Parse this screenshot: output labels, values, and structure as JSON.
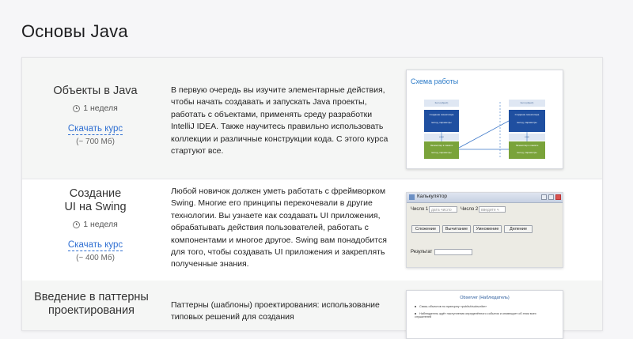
{
  "page": {
    "title": "Основы Java"
  },
  "courses": [
    {
      "title": "Объекты в Java",
      "duration": "1 неделя",
      "download_label": "Скачать курс",
      "size": "(~ 700 Мб)",
      "description": "В первую очередь вы изучите элементарные действия, чтобы начать создавать и запускать Java проекты, работать с объектами, применять среду разработки IntelliJ IDEA. Также научитесь правильно использовать коллекции и различные конструкции кода. С этого курса стартуют все.",
      "thumb": {
        "slide_title": "Схема работы",
        "left_top": "Item.(object)",
        "left_mid": "Создание экземпляра",
        "left_mid_sub": "метод, параметры",
        "left_small": "ещё",
        "left_bottom": "Экземпляр в памяти",
        "left_bottom_sub": "метод, параметры",
        "right_top": "Item.(object)",
        "right_mid": "Создание экземпляра",
        "right_mid_sub": "метод, параметры",
        "right_small": "ещё",
        "right_bottom": "Экземпляр в памяти",
        "right_bottom_sub": "метод, параметры"
      }
    },
    {
      "title": "Создание UI на Swing",
      "title_line1": "Создание",
      "title_line2": "UI на Swing",
      "duration": "1 неделя",
      "download_label": "Скачать курс",
      "size": "(~ 400 Мб)",
      "description": "Любой новичок должен уметь работать с фреймворком Swing. Многие его принципы перекочевали в другие технологии. Вы узнаете как создавать UI приложения, обрабатывать действия пользователей, работать с компонентами и многое другое. Swing вам понадобится для того, чтобы создавать UI приложения и закреплять полученные знания.",
      "thumb": {
        "window_title": "Калькулятор",
        "label_num1": "Число 1",
        "placeholder_num1": "дата число",
        "label_num2": "Число 2",
        "placeholder_num2": "введите ч",
        "btn_add": "Сложение",
        "btn_sub": "Вычитание",
        "btn_mul": "Умножение",
        "btn_div": "Деление",
        "label_result": "Результат"
      }
    },
    {
      "title": "Введение в паттерны проектирования",
      "title_line1": "Введение в паттерны",
      "title_line2": "проектирования",
      "description": "Паттерны (шаблоны) проектирования: использование типовых решений для создания",
      "thumb": {
        "doc_title": "Observer (Наблюдатель)",
        "line1": "Связь объектов по принципу «publish/subscribe»",
        "line2": "Наблюдатель ждёт наступления определённого события и оповещает об этом всех слушателей"
      }
    }
  ]
}
